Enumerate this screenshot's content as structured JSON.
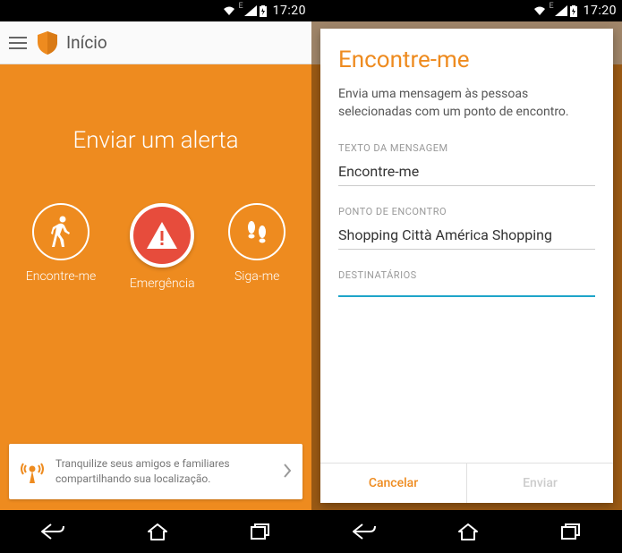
{
  "statusbar": {
    "time": "17:20",
    "network_label": "E"
  },
  "left": {
    "header": {
      "title": "Início"
    },
    "main": {
      "title": "Enviar um alerta",
      "items": [
        {
          "label": "Encontre-me"
        },
        {
          "label": "Emergência"
        },
        {
          "label": "Siga-me"
        }
      ]
    },
    "card": {
      "text": "Tranquilize seus amigos e familiares compartilhando sua localização."
    }
  },
  "right": {
    "dialog": {
      "title": "Encontre-me",
      "description": "Envia uma mensagem às pessoas selecionadas com um ponto de encontro.",
      "fields": {
        "message_label": "TEXTO DA MENSAGEM",
        "message_value": "Encontre-me",
        "place_label": "PONTO DE ENCONTRO",
        "place_value": "Shopping Città América Shopping",
        "recipients_label": "DESTINATÁRIOS",
        "recipients_value": ""
      },
      "actions": {
        "cancel": "Cancelar",
        "send": "Enviar"
      }
    }
  },
  "colors": {
    "accent": "#ee8b1f",
    "danger": "#e74c3c",
    "focus": "#1ea5c9"
  }
}
